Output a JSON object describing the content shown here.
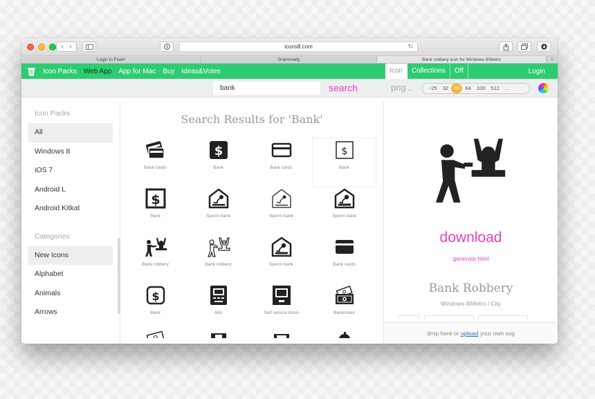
{
  "browser": {
    "url": "icons8.com",
    "tabs": [
      {
        "label": "Login to Fiverr"
      },
      {
        "label": "Grammarly"
      },
      {
        "label": "Bank robbery icon for Windows 8/Metro"
      }
    ],
    "new_tab": "+"
  },
  "nav": {
    "links": [
      "Icon Packs",
      "Web App",
      "App for Mac",
      "Buy",
      "Ideas&Votes"
    ],
    "active_link": "Web App",
    "right_tabs": [
      "Icon",
      "Collections",
      "Off"
    ],
    "login": "Login"
  },
  "search": {
    "value": "bank",
    "button": "search",
    "format": "png",
    "sizes": [
      "~25",
      "32",
      "50",
      "64",
      "100",
      "512",
      "..."
    ],
    "selected_size": "50"
  },
  "sidebar": {
    "packs_heading": "Icon Packs",
    "packs": [
      "All",
      "Windows 8",
      "iOS 7",
      "Android L",
      "Android Kitkat"
    ],
    "active_pack": "All",
    "categories_heading": "Categories",
    "categories": [
      "New Icons",
      "Alphabet",
      "Animals",
      "Arrows"
    ],
    "active_category": "New Icons"
  },
  "results": {
    "title": "Search Results for 'Bank'",
    "items": [
      {
        "label": "Bank cards",
        "icon": "bank-cards-stack-icon"
      },
      {
        "label": "Bank",
        "icon": "bank-dollar-filled-icon"
      },
      {
        "label": "Bank cards",
        "icon": "bank-card-outline-icon"
      },
      {
        "label": "Bank",
        "icon": "bank-dollar-outline-icon"
      },
      {
        "label": "Bank",
        "icon": "bank-dollar-boxed-icon"
      },
      {
        "label": "Sperm bank",
        "icon": "sperm-bank-house-icon"
      },
      {
        "label": "Sperm bank",
        "icon": "sperm-bank-house-thin-icon"
      },
      {
        "label": "Sperm bank",
        "icon": "sperm-bank-house-bold-icon"
      },
      {
        "label": "Bank robbery",
        "icon": "bank-robbery-icon"
      },
      {
        "label": "Bank robbery",
        "icon": "bank-robbery-outline-icon"
      },
      {
        "label": "Sperm bank",
        "icon": "sperm-bank-filled-icon"
      },
      {
        "label": "Bank cards",
        "icon": "bank-card-filled-icon"
      },
      {
        "label": "Bank",
        "icon": "bank-dollar-rounded-icon"
      },
      {
        "label": "Atm",
        "icon": "atm-icon"
      },
      {
        "label": "Self service kiosk",
        "icon": "self-service-kiosk-icon"
      },
      {
        "label": "Banknotes",
        "icon": "banknotes-icon"
      }
    ]
  },
  "preview": {
    "download": "download",
    "generate": "generate html",
    "name": "Bank Robbery",
    "subtitle": "Windows 8/Metro / City",
    "drop_text_before": "drop here or ",
    "drop_link": "upload",
    "drop_text_after": " your own svg"
  },
  "colors": {
    "brand_green": "#2ecc71",
    "accent_pink": "#e744b8",
    "size_selected": "#f5b63a"
  }
}
